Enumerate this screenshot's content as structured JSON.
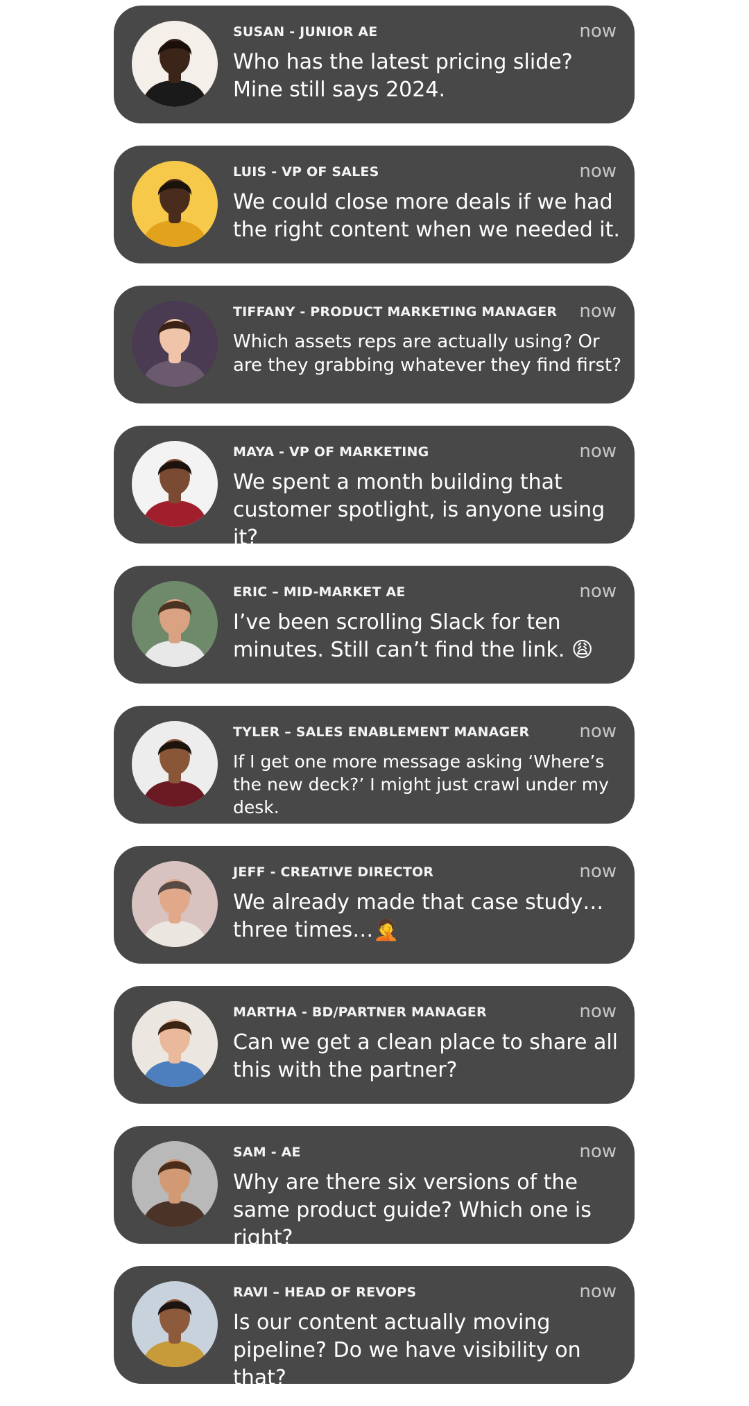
{
  "notifications": [
    {
      "sender": "SUSAN - JUNIOR AE",
      "time": "now",
      "message": "Who has the latest pricing slide? Mine still says 2024.",
      "avatar": {
        "bg": "#f4efe9",
        "skin": "#3b2418",
        "hair": "#1a1009",
        "shirt": "#1a1a1a"
      }
    },
    {
      "sender": "LUIS - VP OF SALES",
      "time": "now",
      "message": "We could close more deals if we had the right content when we needed it.",
      "avatar": {
        "bg": "#f7c94b",
        "skin": "#4a2c1d",
        "hair": "#1b120c",
        "shirt": "#e2a21c"
      }
    },
    {
      "sender": "TIFFANY - PRODUCT MARKETING MANAGER",
      "time": "now",
      "message": "Which assets reps are actually using? Or are they grabbing whatever they find first?",
      "avatar": {
        "bg": "#4a3a52",
        "skin": "#f0c4a8",
        "hair": "#3a2216",
        "shirt": "#6b5a6e"
      }
    },
    {
      "sender": "MAYA - VP OF MARKETING",
      "time": "now",
      "message": "We spent a month building that customer spotlight, is anyone using it?",
      "avatar": {
        "bg": "#f3f3f3",
        "skin": "#7a4a32",
        "hair": "#1c130e",
        "shirt": "#a11f2c"
      }
    },
    {
      "sender": "ERIC – MID-MARKET AE",
      "time": "now",
      "message": "I’ve been scrolling Slack for ten minutes. Still can’t find the link. 😩",
      "avatar": {
        "bg": "#6e8a6a",
        "skin": "#d9a383",
        "hair": "#4a3322",
        "shirt": "#e8e8e8"
      }
    },
    {
      "sender": "TYLER – SALES ENABLEMENT MANAGER",
      "time": "now",
      "message": "If I get one more message asking ‘Where’s the new deck?’ I might just crawl under my desk.",
      "avatar": {
        "bg": "#ededed",
        "skin": "#8a5638",
        "hair": "#1d140e",
        "shirt": "#6b1a24"
      }
    },
    {
      "sender": "JEFF - CREATIVE DIRECTOR",
      "time": "now",
      "message": "We already made that case study… three times…🤦",
      "avatar": {
        "bg": "#d9c3c0",
        "skin": "#e1a98a",
        "hair": "#5a4a44",
        "shirt": "#ece6e0"
      }
    },
    {
      "sender": "MARTHA - BD/PARTNER MANAGER",
      "time": "now",
      "message": "Can we get a clean place to share all this with the partner?",
      "avatar": {
        "bg": "#ece6e0",
        "skin": "#eab89a",
        "hair": "#3c2414",
        "shirt": "#4d7fbf"
      }
    },
    {
      "sender": "SAM - AE",
      "time": "now",
      "message": "Why are there six versions of the same product guide? Which one is right?",
      "avatar": {
        "bg": "#b9b9b9",
        "skin": "#d19a74",
        "hair": "#4a2e1a",
        "shirt": "#4b3327"
      }
    },
    {
      "sender": "RAVI – HEAD OF REVOPS",
      "time": "now",
      "message": "Is our content actually moving pipeline? Do we have visibility on that?",
      "avatar": {
        "bg": "#c8d2dc",
        "skin": "#8e5a3c",
        "hair": "#1b1410",
        "shirt": "#c79a3a"
      }
    }
  ]
}
